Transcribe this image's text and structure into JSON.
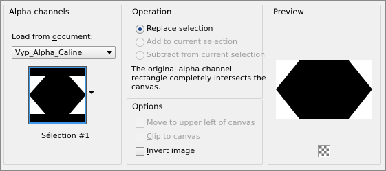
{
  "alpha_channels": {
    "title": "Alpha channels",
    "load_from_label_pre": "Load from ",
    "load_from_label_u": "d",
    "load_from_label_post": "ocument:",
    "document_value": "Vyp_Alpha_Caline",
    "selection_name": "Sélection #1"
  },
  "operation": {
    "title": "Operation",
    "replace": {
      "u": "R",
      "rest": "eplace selection",
      "checked": true
    },
    "add": {
      "u": "A",
      "rest": "dd to current selection",
      "enabled": false
    },
    "subtract": {
      "u": "S",
      "rest": "ubtract from current selection",
      "enabled": false
    },
    "description": [
      "The original alpha channel",
      "rectangle completely intersects the",
      "canvas."
    ]
  },
  "options": {
    "title": "Options",
    "move": {
      "u": "M",
      "rest": "ove to upper left of canvas",
      "enabled": false
    },
    "clip": {
      "u": "C",
      "rest": "lip to canvas",
      "enabled": false
    },
    "invert": {
      "u": "I",
      "rest": "nvert image",
      "enabled": true
    }
  },
  "preview": {
    "title": "Preview",
    "button_icon": "checkerboard-icon"
  },
  "colors": {
    "accent": "#3d96e8",
    "radio_dot": "#15428b",
    "disabled_text": "#a0a0a0"
  }
}
